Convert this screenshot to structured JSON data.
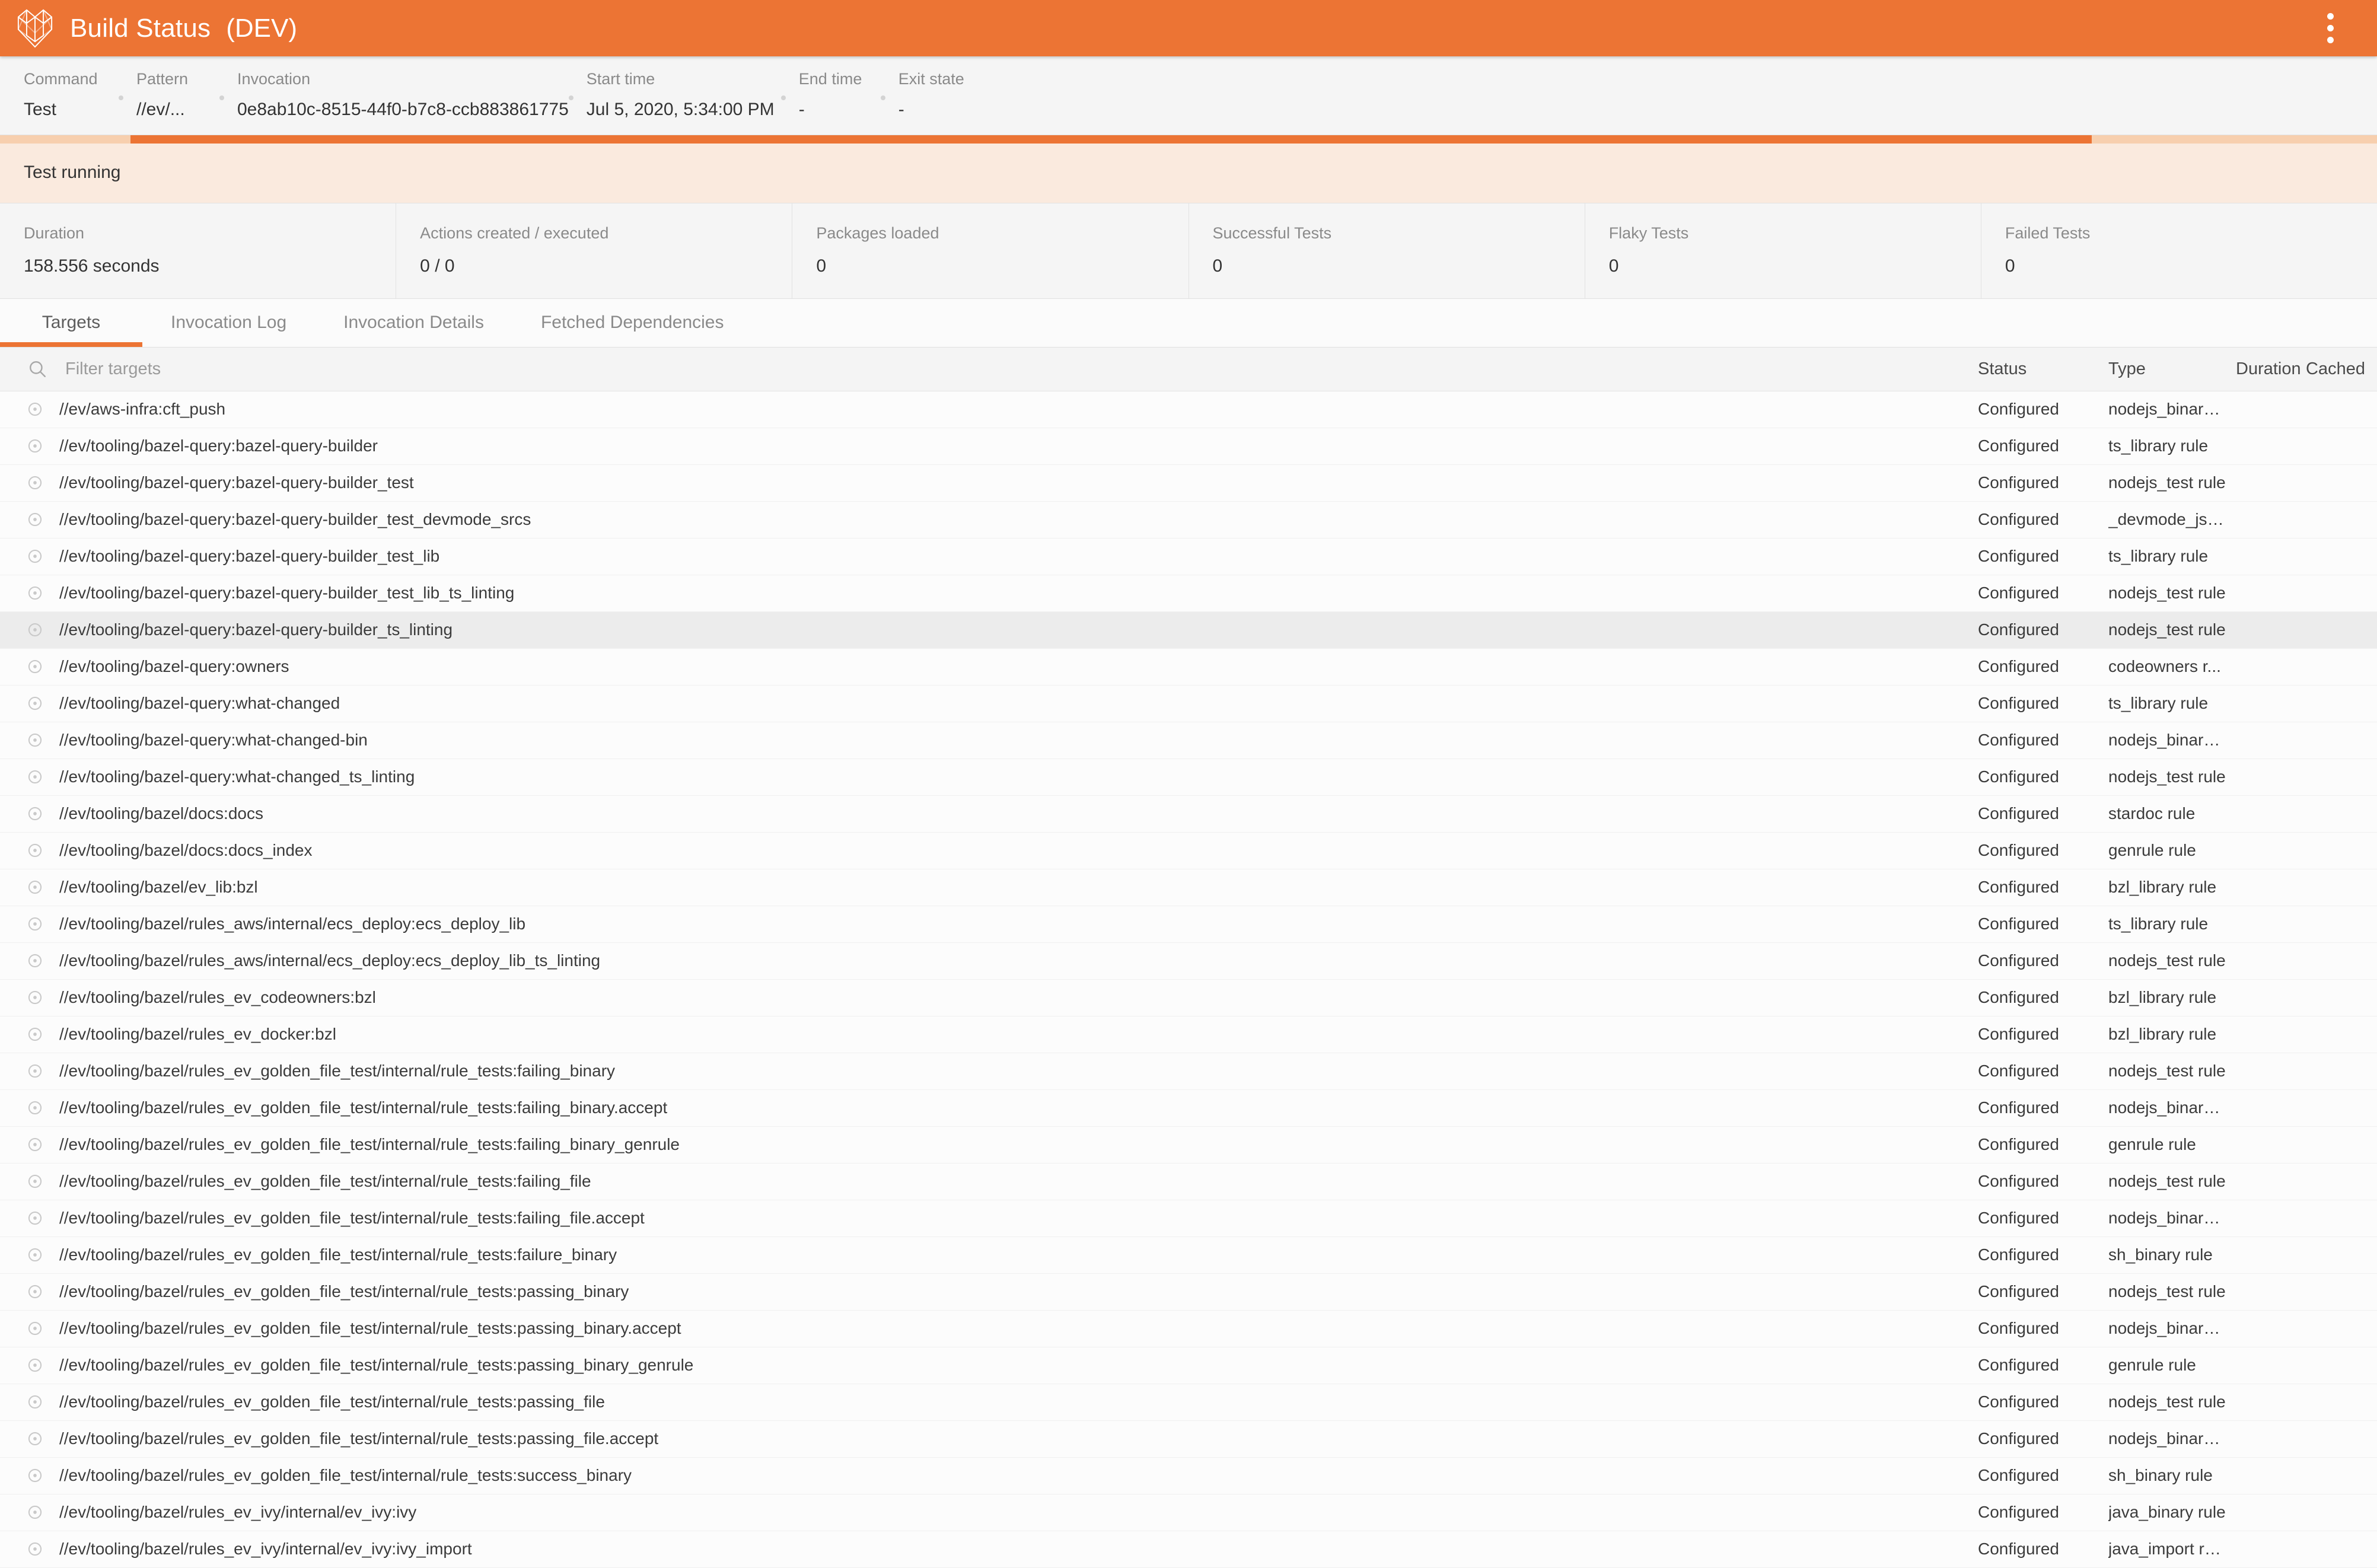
{
  "header": {
    "title": "Build Status",
    "env": "(DEV)",
    "menu_icon": "kebab-menu-icon",
    "accent_color": "#ec7434"
  },
  "meta": [
    {
      "label": "Command",
      "value": "Test"
    },
    {
      "label": "Pattern",
      "value": "//ev/..."
    },
    {
      "label": "Invocation",
      "value": "0e8ab10c-8515-44f0-b7c8-ccb883861775"
    },
    {
      "label": "Start time",
      "value": "Jul 5, 2020, 5:34:00 PM"
    },
    {
      "label": "End time",
      "value": "-"
    },
    {
      "label": "Exit state",
      "value": "-"
    }
  ],
  "status": {
    "text": "Test running",
    "progress_indeterminate": true,
    "banner_bg": "#faeade",
    "track_color": "#f7cfae",
    "bar_color": "#ec7434"
  },
  "stats": [
    {
      "label": "Duration",
      "value": "158.556 seconds"
    },
    {
      "label": "Actions created / executed",
      "value": "0 / 0"
    },
    {
      "label": "Packages loaded",
      "value": "0"
    },
    {
      "label": "Successful Tests",
      "value": "0"
    },
    {
      "label": "Flaky Tests",
      "value": "0"
    },
    {
      "label": "Failed Tests",
      "value": "0"
    }
  ],
  "tabs": [
    {
      "label": "Targets",
      "active": true
    },
    {
      "label": "Invocation Log",
      "active": false
    },
    {
      "label": "Invocation Details",
      "active": false
    },
    {
      "label": "Fetched Dependencies",
      "active": false
    }
  ],
  "filter": {
    "placeholder": "Filter targets",
    "value": "",
    "icon": "search-icon"
  },
  "table": {
    "columns": [
      "Status",
      "Type",
      "Duration",
      "Cached"
    ],
    "target_column_header": "",
    "rows": [
      {
        "target": "//ev/aws-infra:cft_push",
        "status": "Configured",
        "type": "nodejs_binary ...",
        "duration": "",
        "cached": "",
        "hovered": false
      },
      {
        "target": "//ev/tooling/bazel-query:bazel-query-builder",
        "status": "Configured",
        "type": "ts_library rule",
        "duration": "",
        "cached": "",
        "hovered": false
      },
      {
        "target": "//ev/tooling/bazel-query:bazel-query-builder_test",
        "status": "Configured",
        "type": "nodejs_test rule",
        "duration": "",
        "cached": "",
        "hovered": false
      },
      {
        "target": "//ev/tooling/bazel-query:bazel-query-builder_test_devmode_srcs",
        "status": "Configured",
        "type": "_devmode_js_...",
        "duration": "",
        "cached": "",
        "hovered": false
      },
      {
        "target": "//ev/tooling/bazel-query:bazel-query-builder_test_lib",
        "status": "Configured",
        "type": "ts_library rule",
        "duration": "",
        "cached": "",
        "hovered": false
      },
      {
        "target": "//ev/tooling/bazel-query:bazel-query-builder_test_lib_ts_linting",
        "status": "Configured",
        "type": "nodejs_test rule",
        "duration": "",
        "cached": "",
        "hovered": false
      },
      {
        "target": "//ev/tooling/bazel-query:bazel-query-builder_ts_linting",
        "status": "Configured",
        "type": "nodejs_test rule",
        "duration": "",
        "cached": "",
        "hovered": true
      },
      {
        "target": "//ev/tooling/bazel-query:owners",
        "status": "Configured",
        "type": "codeowners r...",
        "duration": "",
        "cached": "",
        "hovered": false
      },
      {
        "target": "//ev/tooling/bazel-query:what-changed",
        "status": "Configured",
        "type": "ts_library rule",
        "duration": "",
        "cached": "",
        "hovered": false
      },
      {
        "target": "//ev/tooling/bazel-query:what-changed-bin",
        "status": "Configured",
        "type": "nodejs_binary ...",
        "duration": "",
        "cached": "",
        "hovered": false
      },
      {
        "target": "//ev/tooling/bazel-query:what-changed_ts_linting",
        "status": "Configured",
        "type": "nodejs_test rule",
        "duration": "",
        "cached": "",
        "hovered": false
      },
      {
        "target": "//ev/tooling/bazel/docs:docs",
        "status": "Configured",
        "type": "stardoc rule",
        "duration": "",
        "cached": "",
        "hovered": false
      },
      {
        "target": "//ev/tooling/bazel/docs:docs_index",
        "status": "Configured",
        "type": "genrule rule",
        "duration": "",
        "cached": "",
        "hovered": false
      },
      {
        "target": "//ev/tooling/bazel/ev_lib:bzl",
        "status": "Configured",
        "type": "bzl_library rule",
        "duration": "",
        "cached": "",
        "hovered": false
      },
      {
        "target": "//ev/tooling/bazel/rules_aws/internal/ecs_deploy:ecs_deploy_lib",
        "status": "Configured",
        "type": "ts_library rule",
        "duration": "",
        "cached": "",
        "hovered": false
      },
      {
        "target": "//ev/tooling/bazel/rules_aws/internal/ecs_deploy:ecs_deploy_lib_ts_linting",
        "status": "Configured",
        "type": "nodejs_test rule",
        "duration": "",
        "cached": "",
        "hovered": false
      },
      {
        "target": "//ev/tooling/bazel/rules_ev_codeowners:bzl",
        "status": "Configured",
        "type": "bzl_library rule",
        "duration": "",
        "cached": "",
        "hovered": false
      },
      {
        "target": "//ev/tooling/bazel/rules_ev_docker:bzl",
        "status": "Configured",
        "type": "bzl_library rule",
        "duration": "",
        "cached": "",
        "hovered": false
      },
      {
        "target": "//ev/tooling/bazel/rules_ev_golden_file_test/internal/rule_tests:failing_binary",
        "status": "Configured",
        "type": "nodejs_test rule",
        "duration": "",
        "cached": "",
        "hovered": false
      },
      {
        "target": "//ev/tooling/bazel/rules_ev_golden_file_test/internal/rule_tests:failing_binary.accept",
        "status": "Configured",
        "type": "nodejs_binary ...",
        "duration": "",
        "cached": "",
        "hovered": false
      },
      {
        "target": "//ev/tooling/bazel/rules_ev_golden_file_test/internal/rule_tests:failing_binary_genrule",
        "status": "Configured",
        "type": "genrule rule",
        "duration": "",
        "cached": "",
        "hovered": false
      },
      {
        "target": "//ev/tooling/bazel/rules_ev_golden_file_test/internal/rule_tests:failing_file",
        "status": "Configured",
        "type": "nodejs_test rule",
        "duration": "",
        "cached": "",
        "hovered": false
      },
      {
        "target": "//ev/tooling/bazel/rules_ev_golden_file_test/internal/rule_tests:failing_file.accept",
        "status": "Configured",
        "type": "nodejs_binary ...",
        "duration": "",
        "cached": "",
        "hovered": false
      },
      {
        "target": "//ev/tooling/bazel/rules_ev_golden_file_test/internal/rule_tests:failure_binary",
        "status": "Configured",
        "type": "sh_binary rule",
        "duration": "",
        "cached": "",
        "hovered": false
      },
      {
        "target": "//ev/tooling/bazel/rules_ev_golden_file_test/internal/rule_tests:passing_binary",
        "status": "Configured",
        "type": "nodejs_test rule",
        "duration": "",
        "cached": "",
        "hovered": false
      },
      {
        "target": "//ev/tooling/bazel/rules_ev_golden_file_test/internal/rule_tests:passing_binary.accept",
        "status": "Configured",
        "type": "nodejs_binary ...",
        "duration": "",
        "cached": "",
        "hovered": false
      },
      {
        "target": "//ev/tooling/bazel/rules_ev_golden_file_test/internal/rule_tests:passing_binary_genrule",
        "status": "Configured",
        "type": "genrule rule",
        "duration": "",
        "cached": "",
        "hovered": false
      },
      {
        "target": "//ev/tooling/bazel/rules_ev_golden_file_test/internal/rule_tests:passing_file",
        "status": "Configured",
        "type": "nodejs_test rule",
        "duration": "",
        "cached": "",
        "hovered": false
      },
      {
        "target": "//ev/tooling/bazel/rules_ev_golden_file_test/internal/rule_tests:passing_file.accept",
        "status": "Configured",
        "type": "nodejs_binary ...",
        "duration": "",
        "cached": "",
        "hovered": false
      },
      {
        "target": "//ev/tooling/bazel/rules_ev_golden_file_test/internal/rule_tests:success_binary",
        "status": "Configured",
        "type": "sh_binary rule",
        "duration": "",
        "cached": "",
        "hovered": false
      },
      {
        "target": "//ev/tooling/bazel/rules_ev_ivy/internal/ev_ivy:ivy",
        "status": "Configured",
        "type": "java_binary rule",
        "duration": "",
        "cached": "",
        "hovered": false
      },
      {
        "target": "//ev/tooling/bazel/rules_ev_ivy/internal/ev_ivy:ivy_import",
        "status": "Configured",
        "type": "java_import rule",
        "duration": "",
        "cached": "",
        "hovered": false
      }
    ]
  }
}
